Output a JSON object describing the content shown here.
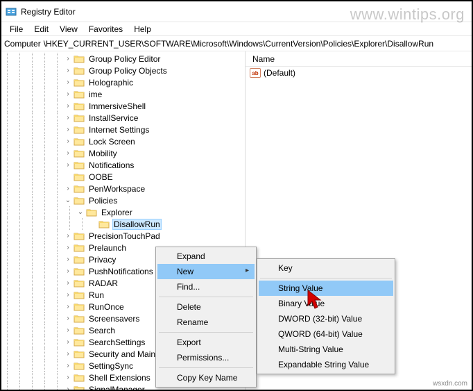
{
  "window": {
    "title": "Registry Editor"
  },
  "menubar": {
    "file": "File",
    "edit": "Edit",
    "view": "View",
    "favorites": "Favorites",
    "help": "Help"
  },
  "address": {
    "label": "Computer",
    "path": "\\HKEY_CURRENT_USER\\SOFTWARE\\Microsoft\\Windows\\CurrentVersion\\Policies\\Explorer\\DisallowRun"
  },
  "tree": {
    "items": [
      {
        "depth": 5,
        "toggle": ">",
        "label": "Group Policy Editor"
      },
      {
        "depth": 5,
        "toggle": ">",
        "label": "Group Policy Objects"
      },
      {
        "depth": 5,
        "toggle": ">",
        "label": "Holographic"
      },
      {
        "depth": 5,
        "toggle": ">",
        "label": "ime"
      },
      {
        "depth": 5,
        "toggle": ">",
        "label": "ImmersiveShell"
      },
      {
        "depth": 5,
        "toggle": ">",
        "label": "InstallService"
      },
      {
        "depth": 5,
        "toggle": ">",
        "label": "Internet Settings"
      },
      {
        "depth": 5,
        "toggle": ">",
        "label": "Lock Screen"
      },
      {
        "depth": 5,
        "toggle": ">",
        "label": "Mobility"
      },
      {
        "depth": 5,
        "toggle": ">",
        "label": "Notifications"
      },
      {
        "depth": 5,
        "toggle": "",
        "label": "OOBE"
      },
      {
        "depth": 5,
        "toggle": ">",
        "label": "PenWorkspace"
      },
      {
        "depth": 5,
        "toggle": "v",
        "label": "Policies"
      },
      {
        "depth": 6,
        "toggle": "v",
        "label": "Explorer"
      },
      {
        "depth": 7,
        "toggle": "",
        "label": "DisallowRun",
        "selected": true
      },
      {
        "depth": 5,
        "toggle": ">",
        "label": "PrecisionTouchPad"
      },
      {
        "depth": 5,
        "toggle": ">",
        "label": "Prelaunch"
      },
      {
        "depth": 5,
        "toggle": ">",
        "label": "Privacy"
      },
      {
        "depth": 5,
        "toggle": ">",
        "label": "PushNotifications"
      },
      {
        "depth": 5,
        "toggle": ">",
        "label": "RADAR"
      },
      {
        "depth": 5,
        "toggle": ">",
        "label": "Run"
      },
      {
        "depth": 5,
        "toggle": ">",
        "label": "RunOnce"
      },
      {
        "depth": 5,
        "toggle": ">",
        "label": "Screensavers"
      },
      {
        "depth": 5,
        "toggle": ">",
        "label": "Search"
      },
      {
        "depth": 5,
        "toggle": ">",
        "label": "SearchSettings"
      },
      {
        "depth": 5,
        "toggle": ">",
        "label": "Security and Maintenance"
      },
      {
        "depth": 5,
        "toggle": ">",
        "label": "SettingSync"
      },
      {
        "depth": 5,
        "toggle": ">",
        "label": "Shell Extensions"
      },
      {
        "depth": 5,
        "toggle": ">",
        "label": "SignalManager"
      }
    ]
  },
  "list": {
    "header": {
      "name": "Name"
    },
    "rows": [
      {
        "icon": "ab",
        "name": "(Default)"
      }
    ]
  },
  "context1": {
    "items": [
      {
        "label": "Expand",
        "type": "item"
      },
      {
        "label": "New",
        "type": "item",
        "sub": true,
        "hl": true
      },
      {
        "label": "Find...",
        "type": "item"
      },
      {
        "type": "sep"
      },
      {
        "label": "Delete",
        "type": "item"
      },
      {
        "label": "Rename",
        "type": "item"
      },
      {
        "type": "sep"
      },
      {
        "label": "Export",
        "type": "item"
      },
      {
        "label": "Permissions...",
        "type": "item"
      },
      {
        "type": "sep"
      },
      {
        "label": "Copy Key Name",
        "type": "item"
      }
    ]
  },
  "context2": {
    "items": [
      {
        "label": "Key",
        "type": "item"
      },
      {
        "type": "sep"
      },
      {
        "label": "String Value",
        "type": "item",
        "hl": true
      },
      {
        "label": "Binary Value",
        "type": "item"
      },
      {
        "label": "DWORD (32-bit) Value",
        "type": "item"
      },
      {
        "label": "QWORD (64-bit) Value",
        "type": "item"
      },
      {
        "label": "Multi-String Value",
        "type": "item"
      },
      {
        "label": "Expandable String Value",
        "type": "item"
      }
    ]
  },
  "watermark": "www.wintips.org",
  "credit": "wsxdn.com"
}
